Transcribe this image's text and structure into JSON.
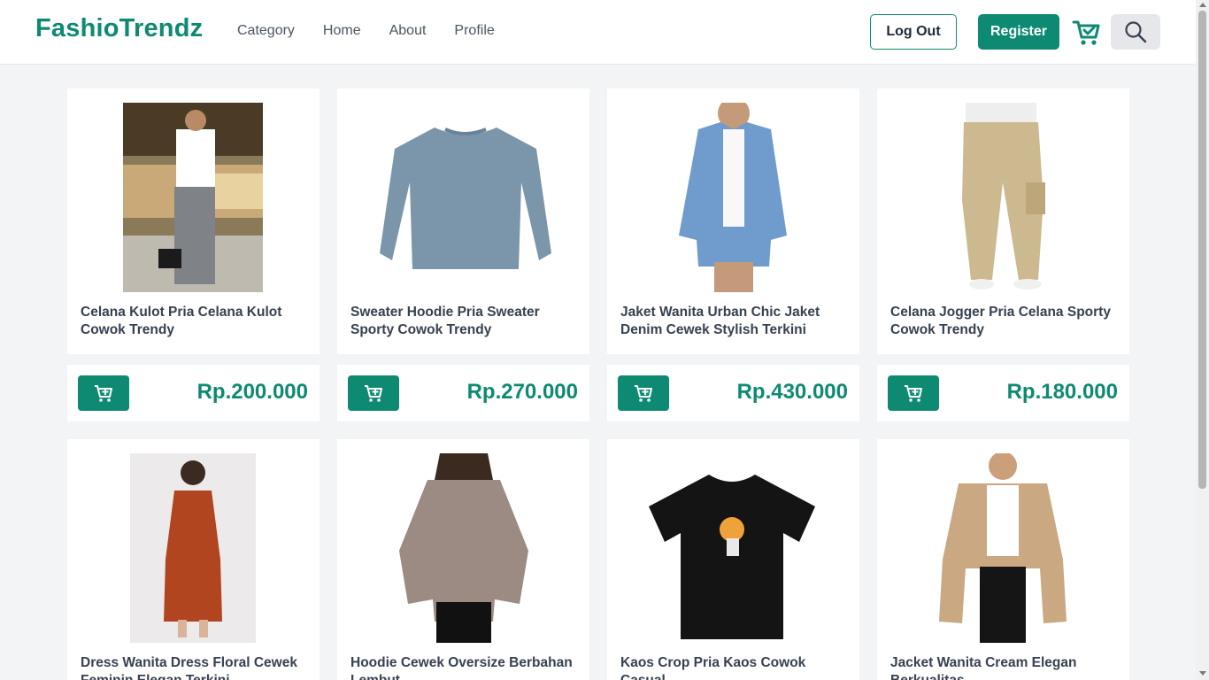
{
  "brand": "FashioTrendz",
  "nav": {
    "links": [
      "Category",
      "Home",
      "About",
      "Profile"
    ]
  },
  "header": {
    "logout_label": "Log Out",
    "register_label": "Register"
  },
  "icons": {
    "cart": "cart-check-icon",
    "search": "search-icon",
    "add_to_cart": "cart-plus-icon"
  },
  "colors": {
    "accent": "#0e8a72",
    "page_bg": "#f3f4f6"
  },
  "products": [
    {
      "name": "Celana Kulot Pria Celana Kulot Cowok Trendy",
      "price": "Rp.200.000"
    },
    {
      "name": "Sweater Hoodie Pria Sweater Sporty Cowok Trendy",
      "price": "Rp.270.000"
    },
    {
      "name": "Jaket Wanita Urban Chic Jaket Denim Cewek Stylish Terkini",
      "price": "Rp.430.000"
    },
    {
      "name": "Celana Jogger Pria Celana Sporty Cowok Trendy",
      "price": "Rp.180.000"
    },
    {
      "name": "Dress Wanita Dress Floral Cewek Feminin Elegan Terkini"
    },
    {
      "name": "Hoodie Cewek Oversize Berbahan Lembut"
    },
    {
      "name": "Kaos Crop Pria Kaos Cowok Casual"
    },
    {
      "name": "Jacket Wanita Cream Elegan Berkualitas"
    }
  ]
}
